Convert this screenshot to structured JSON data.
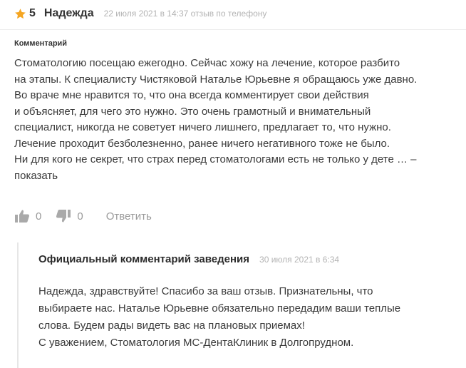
{
  "review": {
    "rating": "5",
    "author": "Надежда",
    "meta": "22 июля 2021 в 14:37 отзыв по телефону",
    "section_label": "Комментарий",
    "text_lines": [
      "Стоматологию посещаю ежегодно. Сейчас хожу на лечение, которое разбито",
      "на этапы. К специалисту Чистяковой Наталье Юрьевне я обращаюсь уже давно.",
      "Во враче мне нравится то, что она всегда комментирует свои действия",
      "и объясняет, для чего это нужно. Это очень грамотный и внимательный",
      "специалист, никогда не советует ничего лишнего, предлагает то, что нужно.",
      "Лечение проходит безболезненно, ранее ничего негативного тоже не было.",
      "Ни для кого не секрет, что страх перед стоматологами есть не только у дете … –"
    ],
    "more_link": "показать",
    "likes": "0",
    "dislikes": "0",
    "reply_label": "Ответить"
  },
  "official": {
    "title": "Официальный комментарий заведения",
    "date": "30 июля 2021 в 6:34",
    "text_lines": [
      "Надежда, здравствуйте! Спасибо за ваш отзыв. Признательны, что",
      "выбираете нас. Наталье Юрьевне обязательно передадим ваши теплые",
      "слова. Будем рады видеть вас на плановых приемах!",
      "С уважением, Стоматология МС-ДентаКлиник в Долгопрудном."
    ]
  },
  "icons": {
    "rating": "star-icon",
    "like": "thumbs-up-icon",
    "dislike": "thumbs-down-icon"
  },
  "colors": {
    "star": "#f5a623",
    "muted": "#9a9a9a",
    "date": "#b4b4b4",
    "text": "#3a3a3a"
  }
}
